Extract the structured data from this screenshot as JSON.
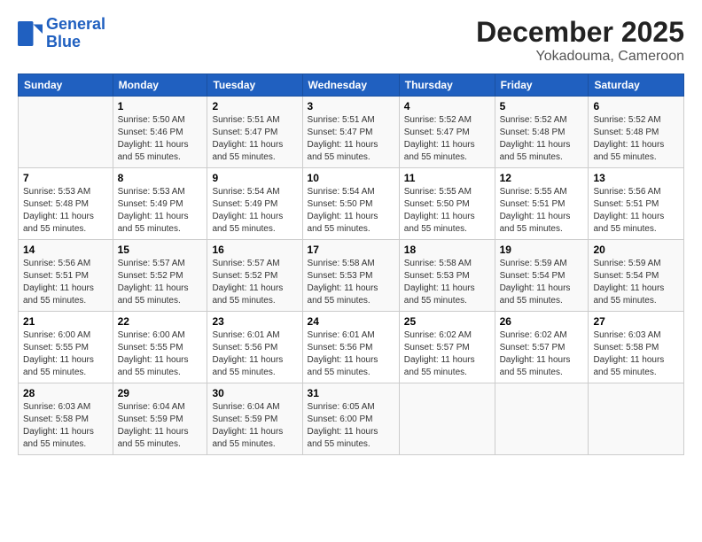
{
  "header": {
    "logo_line1": "General",
    "logo_line2": "Blue",
    "title": "December 2025",
    "subtitle": "Yokadouma, Cameroon"
  },
  "weekdays": [
    "Sunday",
    "Monday",
    "Tuesday",
    "Wednesday",
    "Thursday",
    "Friday",
    "Saturday"
  ],
  "weeks": [
    [
      {
        "day": "",
        "sunrise": "",
        "sunset": "",
        "daylight": ""
      },
      {
        "day": "1",
        "sunrise": "5:50 AM",
        "sunset": "5:46 PM",
        "daylight": "11 hours and 55 minutes."
      },
      {
        "day": "2",
        "sunrise": "5:51 AM",
        "sunset": "5:47 PM",
        "daylight": "11 hours and 55 minutes."
      },
      {
        "day": "3",
        "sunrise": "5:51 AM",
        "sunset": "5:47 PM",
        "daylight": "11 hours and 55 minutes."
      },
      {
        "day": "4",
        "sunrise": "5:52 AM",
        "sunset": "5:47 PM",
        "daylight": "11 hours and 55 minutes."
      },
      {
        "day": "5",
        "sunrise": "5:52 AM",
        "sunset": "5:48 PM",
        "daylight": "11 hours and 55 minutes."
      },
      {
        "day": "6",
        "sunrise": "5:52 AM",
        "sunset": "5:48 PM",
        "daylight": "11 hours and 55 minutes."
      }
    ],
    [
      {
        "day": "7",
        "sunrise": "5:53 AM",
        "sunset": "5:48 PM",
        "daylight": "11 hours and 55 minutes."
      },
      {
        "day": "8",
        "sunrise": "5:53 AM",
        "sunset": "5:49 PM",
        "daylight": "11 hours and 55 minutes."
      },
      {
        "day": "9",
        "sunrise": "5:54 AM",
        "sunset": "5:49 PM",
        "daylight": "11 hours and 55 minutes."
      },
      {
        "day": "10",
        "sunrise": "5:54 AM",
        "sunset": "5:50 PM",
        "daylight": "11 hours and 55 minutes."
      },
      {
        "day": "11",
        "sunrise": "5:55 AM",
        "sunset": "5:50 PM",
        "daylight": "11 hours and 55 minutes."
      },
      {
        "day": "12",
        "sunrise": "5:55 AM",
        "sunset": "5:51 PM",
        "daylight": "11 hours and 55 minutes."
      },
      {
        "day": "13",
        "sunrise": "5:56 AM",
        "sunset": "5:51 PM",
        "daylight": "11 hours and 55 minutes."
      }
    ],
    [
      {
        "day": "14",
        "sunrise": "5:56 AM",
        "sunset": "5:51 PM",
        "daylight": "11 hours and 55 minutes."
      },
      {
        "day": "15",
        "sunrise": "5:57 AM",
        "sunset": "5:52 PM",
        "daylight": "11 hours and 55 minutes."
      },
      {
        "day": "16",
        "sunrise": "5:57 AM",
        "sunset": "5:52 PM",
        "daylight": "11 hours and 55 minutes."
      },
      {
        "day": "17",
        "sunrise": "5:58 AM",
        "sunset": "5:53 PM",
        "daylight": "11 hours and 55 minutes."
      },
      {
        "day": "18",
        "sunrise": "5:58 AM",
        "sunset": "5:53 PM",
        "daylight": "11 hours and 55 minutes."
      },
      {
        "day": "19",
        "sunrise": "5:59 AM",
        "sunset": "5:54 PM",
        "daylight": "11 hours and 55 minutes."
      },
      {
        "day": "20",
        "sunrise": "5:59 AM",
        "sunset": "5:54 PM",
        "daylight": "11 hours and 55 minutes."
      }
    ],
    [
      {
        "day": "21",
        "sunrise": "6:00 AM",
        "sunset": "5:55 PM",
        "daylight": "11 hours and 55 minutes."
      },
      {
        "day": "22",
        "sunrise": "6:00 AM",
        "sunset": "5:55 PM",
        "daylight": "11 hours and 55 minutes."
      },
      {
        "day": "23",
        "sunrise": "6:01 AM",
        "sunset": "5:56 PM",
        "daylight": "11 hours and 55 minutes."
      },
      {
        "day": "24",
        "sunrise": "6:01 AM",
        "sunset": "5:56 PM",
        "daylight": "11 hours and 55 minutes."
      },
      {
        "day": "25",
        "sunrise": "6:02 AM",
        "sunset": "5:57 PM",
        "daylight": "11 hours and 55 minutes."
      },
      {
        "day": "26",
        "sunrise": "6:02 AM",
        "sunset": "5:57 PM",
        "daylight": "11 hours and 55 minutes."
      },
      {
        "day": "27",
        "sunrise": "6:03 AM",
        "sunset": "5:58 PM",
        "daylight": "11 hours and 55 minutes."
      }
    ],
    [
      {
        "day": "28",
        "sunrise": "6:03 AM",
        "sunset": "5:58 PM",
        "daylight": "11 hours and 55 minutes."
      },
      {
        "day": "29",
        "sunrise": "6:04 AM",
        "sunset": "5:59 PM",
        "daylight": "11 hours and 55 minutes."
      },
      {
        "day": "30",
        "sunrise": "6:04 AM",
        "sunset": "5:59 PM",
        "daylight": "11 hours and 55 minutes."
      },
      {
        "day": "31",
        "sunrise": "6:05 AM",
        "sunset": "6:00 PM",
        "daylight": "11 hours and 55 minutes."
      },
      {
        "day": "",
        "sunrise": "",
        "sunset": "",
        "daylight": ""
      },
      {
        "day": "",
        "sunrise": "",
        "sunset": "",
        "daylight": ""
      },
      {
        "day": "",
        "sunrise": "",
        "sunset": "",
        "daylight": ""
      }
    ]
  ]
}
